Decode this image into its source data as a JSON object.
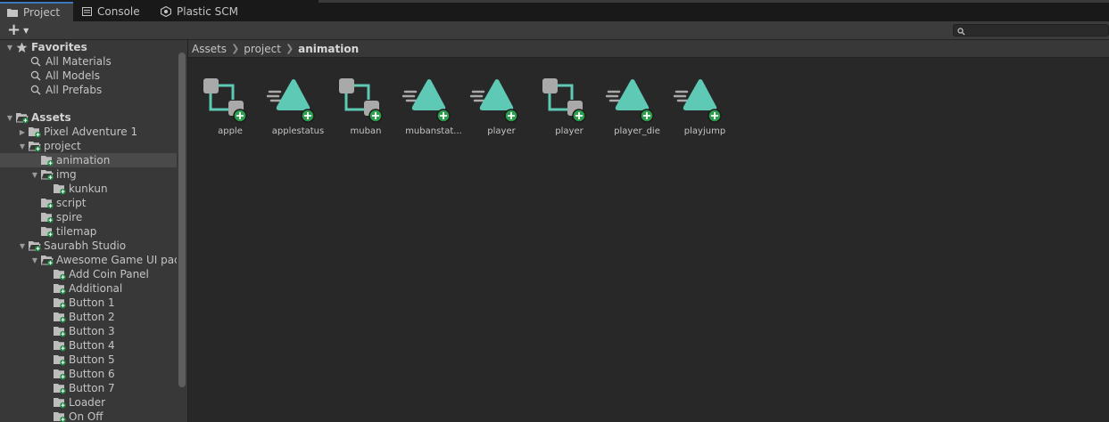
{
  "tabs": [
    {
      "label": "Project",
      "icon": "folder-icon",
      "active": true
    },
    {
      "label": "Console",
      "icon": "console-icon",
      "active": false
    },
    {
      "label": "Plastic SCM",
      "icon": "plastic-scm-icon",
      "active": false
    }
  ],
  "toolbar": {
    "add_icon": "plus-icon",
    "search_placeholder": ""
  },
  "tree": {
    "favorites": {
      "label": "Favorites",
      "items": [
        "All Materials",
        "All Models",
        "All Prefabs"
      ]
    },
    "assets": {
      "label": "Assets",
      "items": [
        "Pixel Adventure 1",
        "project",
        "animation",
        "img",
        "kunkun",
        "script",
        "spire",
        "tilemap",
        "Saurabh Studio",
        "Awesome Game UI pac",
        "Add Coin Panel",
        "Additional",
        "Button 1",
        "Button 2",
        "Button 3",
        "Button 4",
        "Button 5",
        "Button 6",
        "Button 7",
        "Loader",
        "On Off"
      ]
    }
  },
  "breadcrumb": [
    "Assets",
    "project",
    "animation"
  ],
  "assets_grid": [
    {
      "name": "apple",
      "type": "animator-controller"
    },
    {
      "name": "applestatus",
      "type": "animation-clip"
    },
    {
      "name": "muban",
      "type": "animator-controller"
    },
    {
      "name": "mubanstat...",
      "type": "animation-clip"
    },
    {
      "name": "player",
      "type": "animation-clip"
    },
    {
      "name": "player",
      "type": "animator-controller"
    },
    {
      "name": "player_die",
      "type": "animation-clip"
    },
    {
      "name": "playjump",
      "type": "animation-clip"
    }
  ],
  "colors": {
    "accent": "#3a79bb",
    "teal": "#5ec9b4",
    "badge": "#2e9e4e"
  }
}
